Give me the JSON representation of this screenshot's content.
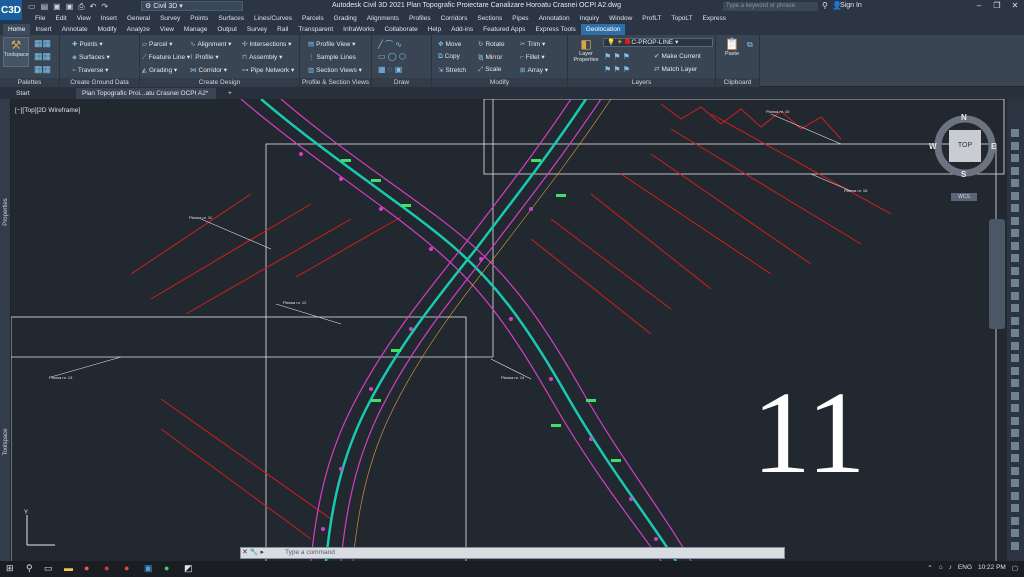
{
  "app": {
    "logo": "C3D",
    "workspace": "Civil 3D",
    "title": "Autodesk Civil 3D 2021    Plan Topografic Proiectare Canalizare Horoatu Crasnei OCPI A2.dwg",
    "search_placeholder": "Type a keyword or phrase",
    "sign_in": "Sign In"
  },
  "menu": [
    "File",
    "Edit",
    "View",
    "Insert",
    "General",
    "Survey",
    "Points",
    "Surfaces",
    "Lines/Curves",
    "Parcels",
    "Grading",
    "Alignments",
    "Profiles",
    "Corridors",
    "Sections",
    "Pipes",
    "Annotation",
    "Inquiry",
    "Window",
    "ProfLT",
    "TopoLT",
    "Express"
  ],
  "ribbon_tabs": [
    "Home",
    "Insert",
    "Annotate",
    "Modify",
    "Analyze",
    "View",
    "Manage",
    "Output",
    "Survey",
    "Rail",
    "Transparent",
    "InfraWorks",
    "Collaborate",
    "Help",
    "Add-ins",
    "Featured Apps",
    "Express Tools",
    "Geolocation"
  ],
  "ribbon": {
    "toolspace": "Toolspace",
    "points": "Points",
    "surfaces": "Surfaces",
    "traverse": "Traverse",
    "parcel": "Parcel",
    "feature_line": "Feature Line",
    "grading": "Grading",
    "alignment": "Alignment",
    "profile": "Profile",
    "corridor": "Corridor",
    "intersections": "Intersections",
    "assembly": "Assembly",
    "pipe_network": "Pipe Network",
    "profile_view": "Profile View",
    "sample_lines": "Sample Lines",
    "section_views": "Section Views",
    "move": "Move",
    "rotate": "Rotate",
    "trim": "Trim",
    "copy": "Copy",
    "mirror": "Mirror",
    "fillet": "Fillet",
    "stretch": "Stretch",
    "scale": "Scale",
    "array": "Array",
    "layer_name": "C-PROP-LINE",
    "layer_properties": "Layer Properties",
    "make_current": "Make Current",
    "match_layer": "Match Layer",
    "paste": "Paste",
    "panels": {
      "palettes": "Palettes",
      "create_ground_data": "Create Ground Data",
      "create_design": "Create Design",
      "profile_section_views": "Profile & Section Views",
      "draw": "Draw",
      "modify": "Modify",
      "layers": "Layers",
      "clipboard": "Clipboard"
    }
  },
  "file_tabs": [
    "Start",
    "Plan Topografic Proi...atu Crasnei OCPI A2*"
  ],
  "viewport": {
    "label": "[−][Top][2D Wireframe]",
    "sheet_number": "11",
    "viewcube": {
      "top": "TOP",
      "n": "N",
      "s": "S",
      "e": "E",
      "w": "W",
      "wcs": "WCS"
    },
    "plot_labels": [
      "Plansa nr. 11",
      "Plansa nr. 12",
      "Plansa nr. 13",
      "Plansa nr. 14",
      "Plansa nr. 15",
      "Plansa nr. 16"
    ]
  },
  "side_palettes": [
    "Properties",
    "Toolspace"
  ],
  "command_placeholder": "Type a command",
  "taskbar": {
    "lang": "ENG",
    "time": "10:22 PM"
  },
  "colors": {
    "accent": "#2f6fa8",
    "road": "#19c9b0",
    "red_lines": "#d61d1d",
    "magenta": "#d63ec2",
    "green_text": "#3fe06a"
  }
}
